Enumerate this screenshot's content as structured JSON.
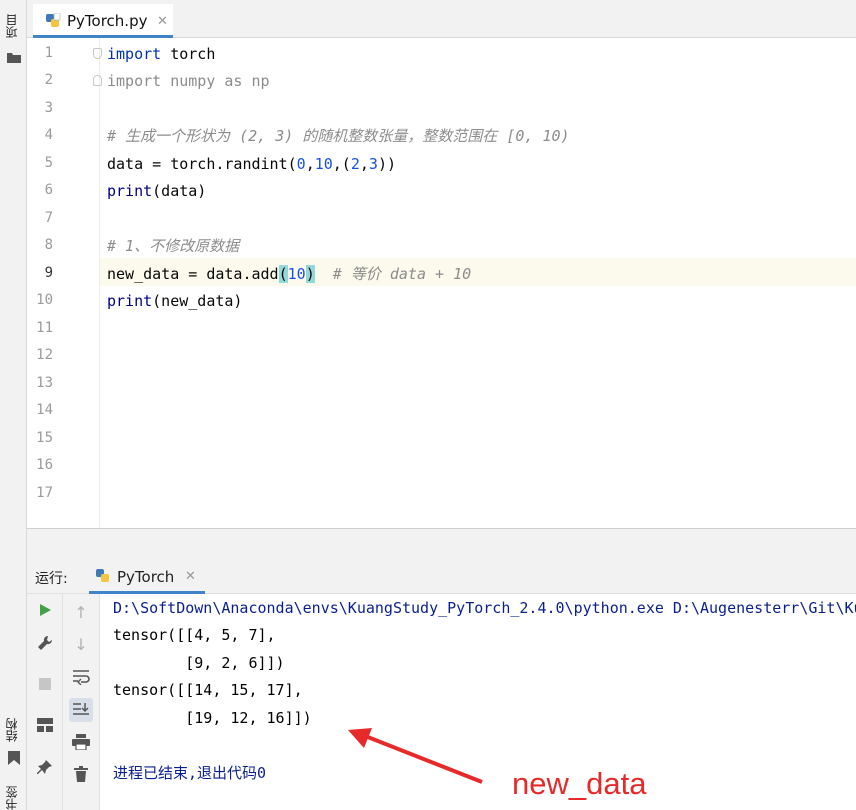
{
  "sidebar": {
    "project_label": "项目",
    "structure_label": "结构"
  },
  "editor": {
    "file_tab": "PyTorch.py",
    "line_numbers": [
      "1",
      "2",
      "3",
      "4",
      "5",
      "6",
      "7",
      "8",
      "9",
      "10",
      "11",
      "12",
      "13",
      "14",
      "15",
      "16",
      "17"
    ],
    "current_line": "9",
    "code": {
      "l1_kw": "import",
      "l1_mod": " torch",
      "l2_kw": "import",
      "l2_mod": " numpy ",
      "l2_as": "as",
      "l2_alias": " np",
      "l4_comment": "# 生成一个形状为 (2, 3) 的随机整数张量，整数范围在 [0, 10)",
      "l5_pre": "data = torch.randint(",
      "l5_n1": "0",
      "l5_c1": ",",
      "l5_n2": "10",
      "l5_mid": ",(",
      "l5_n3": "2",
      "l5_c2": ",",
      "l5_n4": "3",
      "l5_post": "))",
      "l6_fn": "print",
      "l6_args": "(data)",
      "l8_comment": "# 1、不修改原数据",
      "l9_pre": "new_data = data.add",
      "l9_open": "(",
      "l9_num": "10",
      "l9_close": ")",
      "l9_comment": "  # 等价 data + 10",
      "l10_fn": "print",
      "l10_args": "(new_data)"
    }
  },
  "run_panel": {
    "label": "运行:",
    "tab_name": "PyTorch",
    "console_lines": [
      "D:\\SoftDown\\Anaconda\\envs\\KuangStudy_PyTorch_2.4.0\\python.exe D:\\Augenesterr\\Git\\KuangStudy_PyTorch\\PyTorch.py",
      "tensor([[4, 5, 7],",
      "        [9, 2, 6]])",
      "tensor([[14, 15, 17],",
      "        [19, 12, 16]])",
      "进程已结束,退出代码0"
    ]
  },
  "annotation": {
    "text": "new_data",
    "color": "#e62a2a"
  },
  "colors": {
    "accent": "#4083c9",
    "keyword": "#0033b3",
    "number": "#1750eb",
    "comment": "#8c8c8c",
    "run_green": "#43a047"
  }
}
